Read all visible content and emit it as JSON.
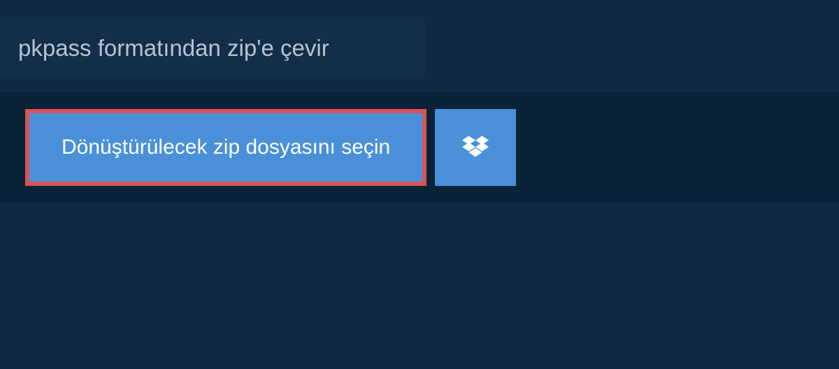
{
  "header": {
    "title": "pkpass formatından zip'e çevir"
  },
  "upload": {
    "select_file_label": "Dönüştürülecek zip dosyasını seçin"
  },
  "colors": {
    "background": "#0f2a42",
    "header_bg": "#132e47",
    "panel_bg": "#0a2238",
    "button_bg": "#4a90d9",
    "button_border": "#d95454",
    "text_light": "#b8c5d0",
    "text_white": "#ffffff"
  }
}
